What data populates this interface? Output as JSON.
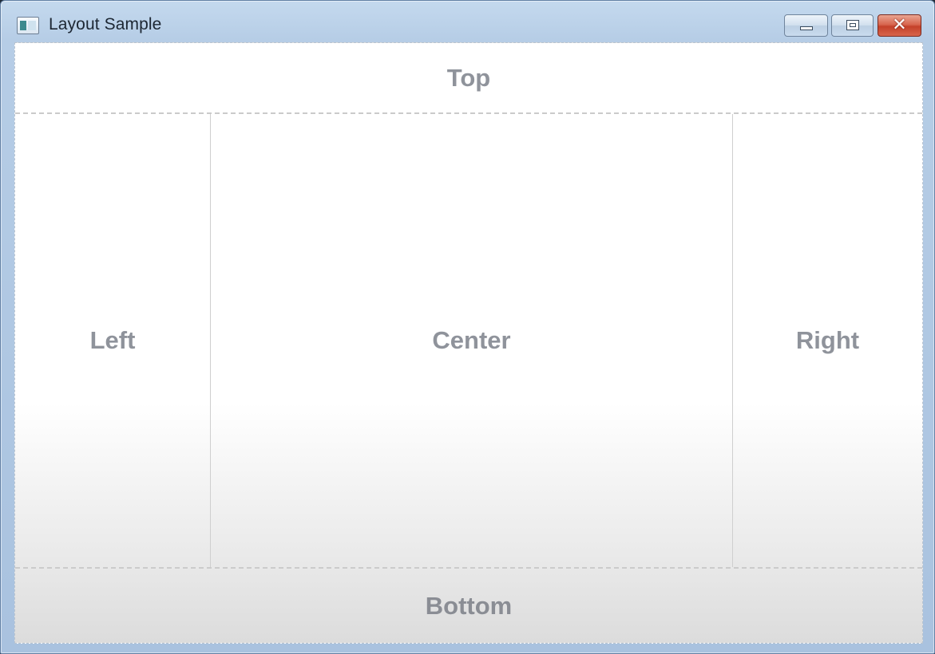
{
  "window": {
    "title": "Layout Sample",
    "icon": "app-window-icon",
    "buttons": {
      "minimize": "minimize-icon",
      "maximize": "maximize-icon",
      "close": "close-icon",
      "close_glyph": "✕"
    }
  },
  "layout": {
    "top": "Top",
    "left": "Left",
    "center": "Center",
    "right": "Right",
    "bottom": "Bottom"
  },
  "colors": {
    "close_button": "#d0533a",
    "label_text": "#8f939b",
    "titlebar": "#b6cde6"
  }
}
